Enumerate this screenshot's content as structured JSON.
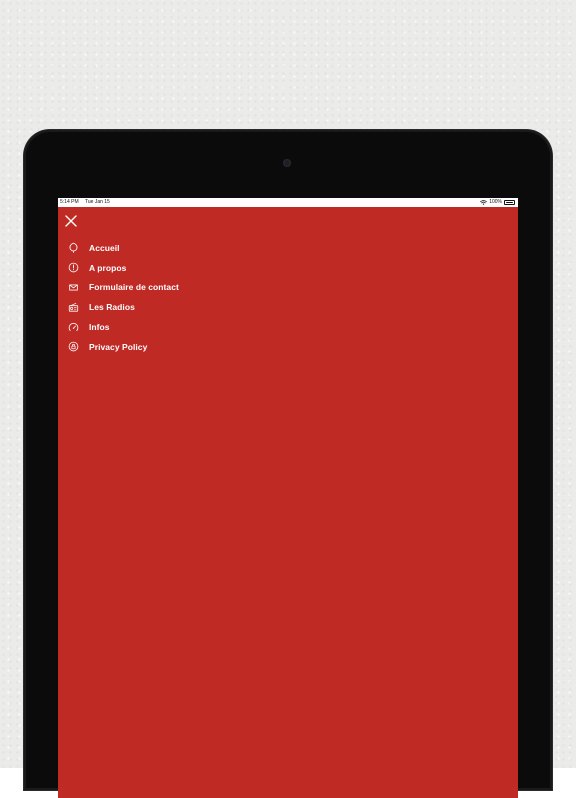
{
  "status_bar": {
    "time": "5:14 PM",
    "date": "Tue Jan 15",
    "battery": "100%",
    "battery_level": 1.0
  },
  "colors": {
    "accent": "#c02a25",
    "menu_text": "#ffffff",
    "bezel": "#0b0b0c"
  },
  "close": {
    "icon": "close-icon"
  },
  "menu": {
    "items": [
      {
        "label": "Accueil",
        "icon": "leaf-icon"
      },
      {
        "label": "A propos",
        "icon": "info-icon"
      },
      {
        "label": "Formulaire de contact",
        "icon": "mail-icon"
      },
      {
        "label": "Les Radios",
        "icon": "radio-icon"
      },
      {
        "label": "Infos",
        "icon": "speedometer-icon"
      },
      {
        "label": "Privacy Policy",
        "icon": "privacy-icon"
      }
    ]
  }
}
